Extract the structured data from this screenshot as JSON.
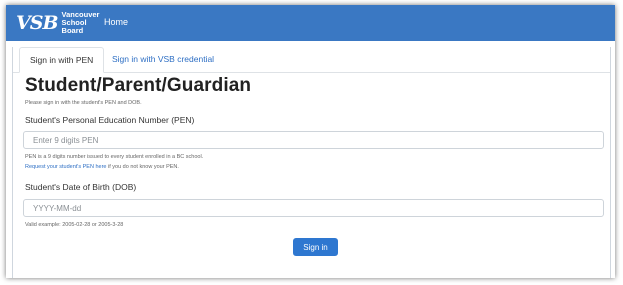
{
  "navbar": {
    "logo_mark": "VSB",
    "logo_line1": "Vancouver",
    "logo_line2": "School Board",
    "home_label": "Home",
    "color": "#3a78c3"
  },
  "tabs": [
    {
      "label": "Sign in with PEN",
      "active": true
    },
    {
      "label": "Sign in with VSB credential",
      "active": false
    }
  ],
  "form": {
    "title": "Student/Parent/Guardian",
    "subtitle": "Please sign in with the student's PEN and DOB.",
    "pen": {
      "label": "Student's Personal Education Number (PEN)",
      "placeholder": "Enter 9 digits PEN",
      "value": "",
      "help_text": "PEN is a 9 digits number issued to every student enrolled in a BC school.",
      "request_link": "Request your student's PEN here",
      "request_suffix": " if you do not know your PEN."
    },
    "dob": {
      "label": "Student's Date of Birth (DOB)",
      "placeholder": "YYYY-MM-dd",
      "value": "",
      "help_text": "Valid example: 2005-02-28 or 2005-3-28"
    },
    "submit_label": "Sign in"
  }
}
